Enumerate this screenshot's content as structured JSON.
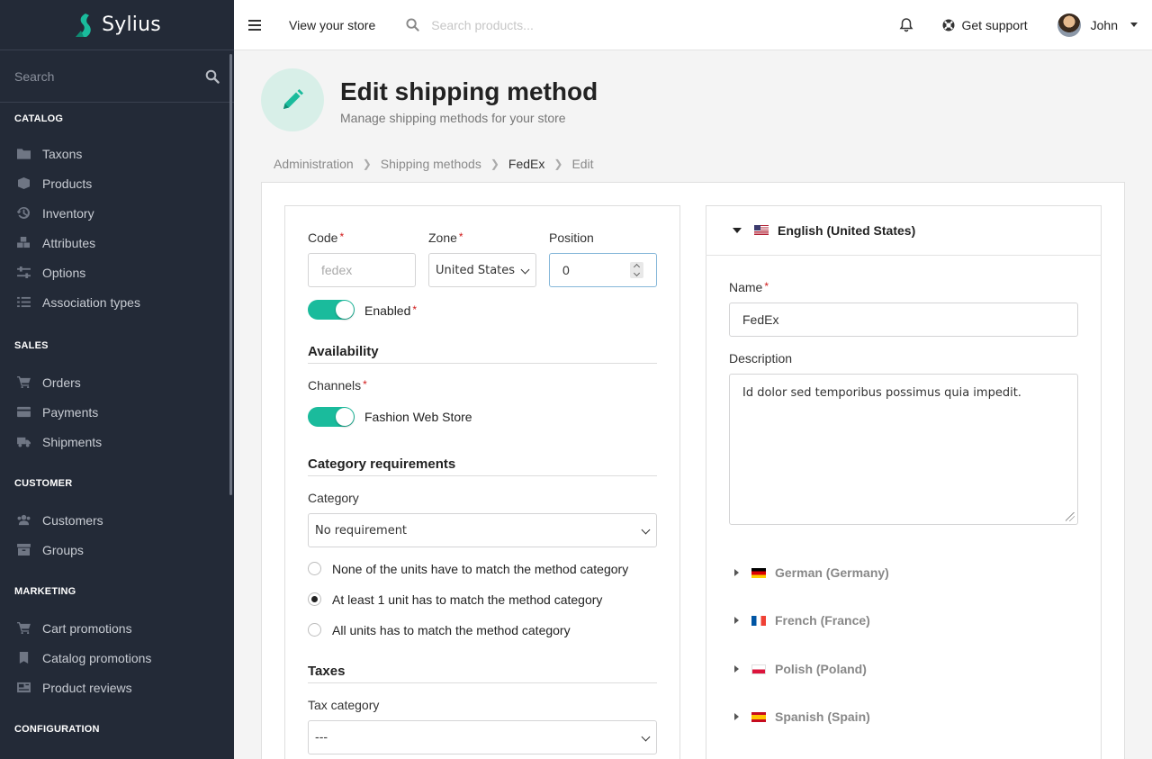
{
  "brand": {
    "name": "Sylius",
    "accent": "#1abb9c"
  },
  "sidebar": {
    "search_placeholder": "Search",
    "sections": [
      {
        "title": "CATALOG",
        "items": [
          {
            "label": "Taxons",
            "icon": "folder-icon"
          },
          {
            "label": "Products",
            "icon": "cube-icon"
          },
          {
            "label": "Inventory",
            "icon": "history-icon"
          },
          {
            "label": "Attributes",
            "icon": "cubes-icon"
          },
          {
            "label": "Options",
            "icon": "sliders-icon"
          },
          {
            "label": "Association types",
            "icon": "tasks-icon"
          }
        ]
      },
      {
        "title": "SALES",
        "items": [
          {
            "label": "Orders",
            "icon": "cart-icon"
          },
          {
            "label": "Payments",
            "icon": "credit-card-icon"
          },
          {
            "label": "Shipments",
            "icon": "truck-icon"
          }
        ]
      },
      {
        "title": "CUSTOMER",
        "items": [
          {
            "label": "Customers",
            "icon": "users-icon"
          },
          {
            "label": "Groups",
            "icon": "archive-icon"
          }
        ]
      },
      {
        "title": "MARKETING",
        "items": [
          {
            "label": "Cart promotions",
            "icon": "cart-icon"
          },
          {
            "label": "Catalog promotions",
            "icon": "bookmark-icon"
          },
          {
            "label": "Product reviews",
            "icon": "newspaper-icon"
          }
        ]
      },
      {
        "title": "CONFIGURATION",
        "items": []
      }
    ]
  },
  "topbar": {
    "view_store": "View your store",
    "search_placeholder": "Search products...",
    "support": "Get support",
    "user": "John"
  },
  "header": {
    "title": "Edit shipping method",
    "subtitle": "Manage shipping methods for your store"
  },
  "breadcrumb": [
    "Administration",
    "Shipping methods",
    "FedEx",
    "Edit"
  ],
  "form": {
    "code_label": "Code",
    "code_value": "fedex",
    "zone_label": "Zone",
    "zone_value": "United States o",
    "position_label": "Position",
    "position_value": "0",
    "enabled_label": "Enabled",
    "availability_title": "Availability",
    "channels_label": "Channels",
    "channel_name": "Fashion Web Store",
    "category_req_title": "Category requirements",
    "category_label": "Category",
    "category_value": "No requirement",
    "radio_options": [
      {
        "label": "None of the units have to match the method category",
        "checked": false
      },
      {
        "label": "At least 1 unit has to match the method category",
        "checked": true
      },
      {
        "label": "All units has to match the method category",
        "checked": false
      }
    ],
    "taxes_title": "Taxes",
    "tax_category_label": "Tax category",
    "tax_category_value": "---"
  },
  "translations": {
    "active_locale": "English (United States)",
    "name_label": "Name",
    "name_value": "FedEx",
    "description_label": "Description",
    "description_value": "Id dolor sed temporibus possimus quia impedit.",
    "other_locales": [
      "German (Germany)",
      "French (France)",
      "Polish (Poland)",
      "Spanish (Spain)"
    ]
  }
}
